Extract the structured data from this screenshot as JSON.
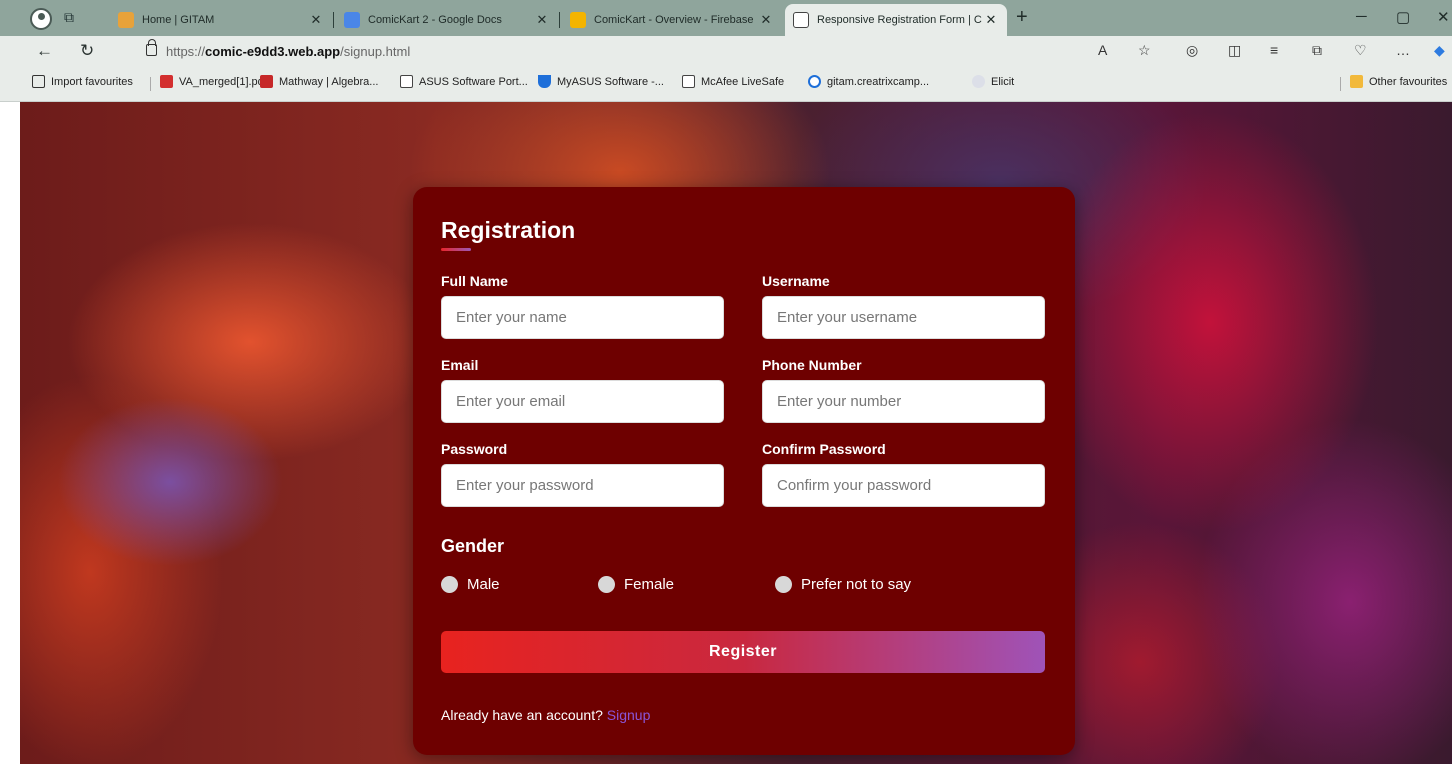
{
  "browser": {
    "tabs": [
      {
        "label": "Home | GITAM",
        "close": "✕",
        "active": false
      },
      {
        "label": "ComicKart 2 - Google Docs",
        "close": "✕",
        "active": false
      },
      {
        "label": "ComicKart - Overview - Firebase",
        "close": "✕",
        "active": false
      },
      {
        "label": "Responsive Registration Form | C",
        "close": "✕",
        "active": true
      }
    ],
    "new_tab": "+",
    "url_prefix": "https://",
    "url_host": "comic-e9dd3.web.app",
    "url_path": "/signup.html",
    "bookmarks": [
      "Import favourites",
      "VA_merged[1].pdf",
      "Mathway | Algebra...",
      "ASUS Software Port...",
      "MyASUS Software -...",
      "McAfee LiveSafe",
      "gitam.creatrixcamp...",
      "Elicit"
    ],
    "other_favourites": "Other favourites"
  },
  "form": {
    "title": "Registration",
    "fields": {
      "full_name": {
        "label": "Full Name",
        "placeholder": "Enter your name"
      },
      "username": {
        "label": "Username",
        "placeholder": "Enter your username"
      },
      "email": {
        "label": "Email",
        "placeholder": "Enter your email"
      },
      "phone": {
        "label": "Phone Number",
        "placeholder": "Enter your number"
      },
      "password": {
        "label": "Password",
        "placeholder": "Enter your password"
      },
      "confirm": {
        "label": "Confirm Password",
        "placeholder": "Confirm your password"
      }
    },
    "gender": {
      "title": "Gender",
      "options": [
        "Male",
        "Female",
        "Prefer not to say"
      ]
    },
    "register_label": "Register",
    "already_text": "Already have an account?",
    "signup_link": "Signup"
  },
  "colors": {
    "card": "#6e0000",
    "link": "#8a55d8",
    "button_start": "#e8231f",
    "button_end": "#9f53b8"
  }
}
